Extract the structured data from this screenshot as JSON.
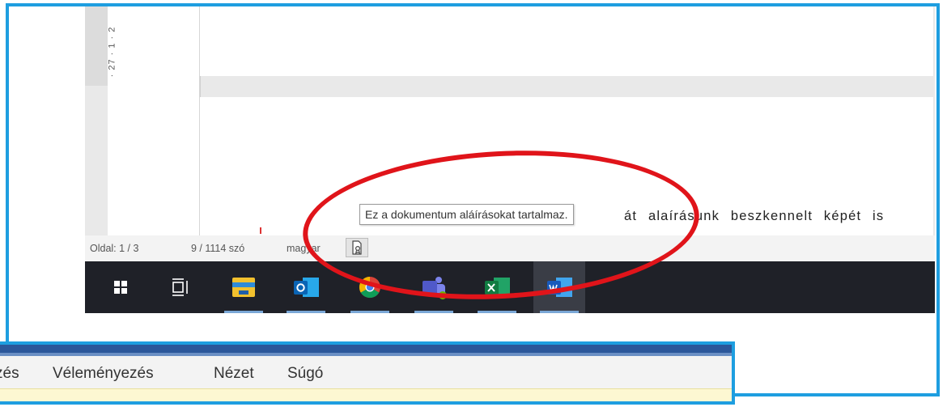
{
  "ruler": {
    "text": "· 27 · 1 · 2"
  },
  "document": {
    "body_text": "át alaírásunk beszkennelt képét is"
  },
  "tooltip": {
    "text": "Ez a dokumentum aláírásokat tartalmaz."
  },
  "statusbar": {
    "page": "Oldal: 1 / 3",
    "words": "9 / 1114 szó",
    "language": "magyar",
    "signature_icon": "document-signature-icon"
  },
  "taskbar": {
    "apps": [
      {
        "icon": "windows-start-icon"
      },
      {
        "icon": "task-view-icon"
      },
      {
        "icon": "file-explorer-icon"
      },
      {
        "icon": "outlook-icon"
      },
      {
        "icon": "chrome-icon"
      },
      {
        "icon": "teams-icon"
      },
      {
        "icon": "excel-icon"
      },
      {
        "icon": "word-icon"
      }
    ]
  },
  "ribbon": {
    "tabs": [
      "zés",
      "Véleményezés",
      "Nézet",
      "Súgó"
    ]
  },
  "colors": {
    "frame_border": "#1e9ee0",
    "annotation": "#e0141a",
    "taskbar_bg": "#1f2128",
    "word_blue": "#2b579a"
  }
}
